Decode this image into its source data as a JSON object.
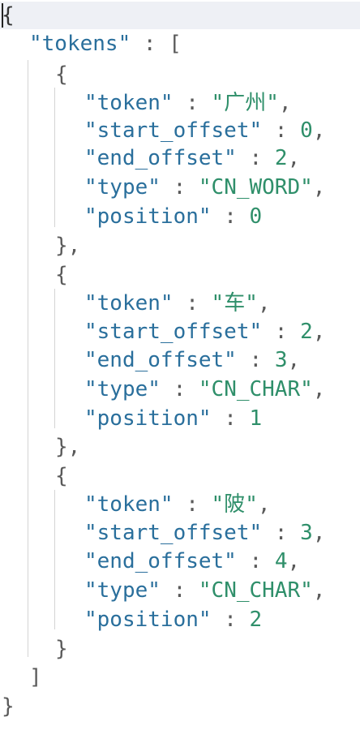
{
  "editor": {
    "open_root": "{",
    "close_root": "}",
    "tokens_key": "\"tokens\"",
    "colon": " : ",
    "open_array": "[",
    "close_array": "]",
    "open_obj": "{",
    "close_obj_comma": "},",
    "close_obj": "}",
    "keys": {
      "token": "\"token\"",
      "start_offset": "\"start_offset\"",
      "end_offset": "\"end_offset\"",
      "type": "\"type\"",
      "position": "\"position\""
    },
    "items": [
      {
        "token": "\"广州\"",
        "start_offset": "0",
        "end_offset": "2",
        "type": "\"CN_WORD\"",
        "position": "0"
      },
      {
        "token": "\"车\"",
        "start_offset": "2",
        "end_offset": "3",
        "type": "\"CN_CHAR\"",
        "position": "1"
      },
      {
        "token": "\"陂\"",
        "start_offset": "3",
        "end_offset": "4",
        "type": "\"CN_CHAR\"",
        "position": "2"
      }
    ]
  }
}
